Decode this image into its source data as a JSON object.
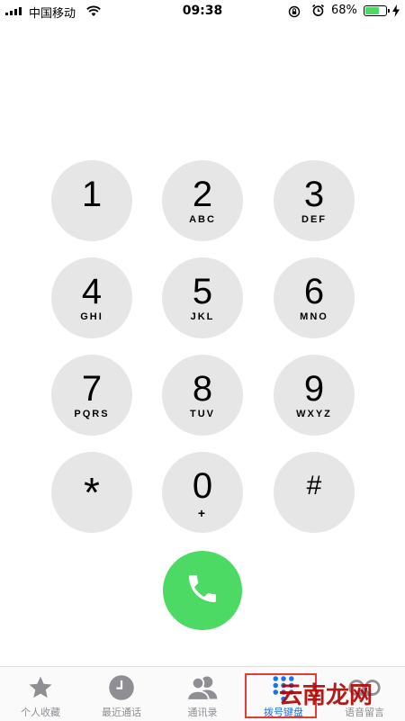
{
  "status_bar": {
    "carrier": "中国移动",
    "time": "09:38",
    "battery_percent": "68%",
    "battery_level": 0.68
  },
  "keypad": {
    "keys": [
      {
        "digit": "1",
        "letters": ""
      },
      {
        "digit": "2",
        "letters": "ABC"
      },
      {
        "digit": "3",
        "letters": "DEF"
      },
      {
        "digit": "4",
        "letters": "GHI"
      },
      {
        "digit": "5",
        "letters": "JKL"
      },
      {
        "digit": "6",
        "letters": "MNO"
      },
      {
        "digit": "7",
        "letters": "PQRS"
      },
      {
        "digit": "8",
        "letters": "TUV"
      },
      {
        "digit": "9",
        "letters": "WXYZ"
      },
      {
        "digit": "*",
        "letters": ""
      },
      {
        "digit": "0",
        "letters": "+"
      },
      {
        "digit": "#",
        "letters": ""
      }
    ]
  },
  "tabbar": {
    "tabs": [
      {
        "label": "个人收藏",
        "icon": "star-icon"
      },
      {
        "label": "最近通话",
        "icon": "clock-icon"
      },
      {
        "label": "通讯录",
        "icon": "contacts-icon"
      },
      {
        "label": "拨号键盘",
        "icon": "keypad-icon"
      },
      {
        "label": "语音留言",
        "icon": "voicemail-icon"
      }
    ],
    "active_index": 3
  },
  "watermark": "云南龙网",
  "colors": {
    "key_bg": "#e6e6e6",
    "call_green": "#4cd964",
    "tab_active": "#1a73e8",
    "tab_inactive": "#8e8e93",
    "highlight": "#e53935"
  }
}
